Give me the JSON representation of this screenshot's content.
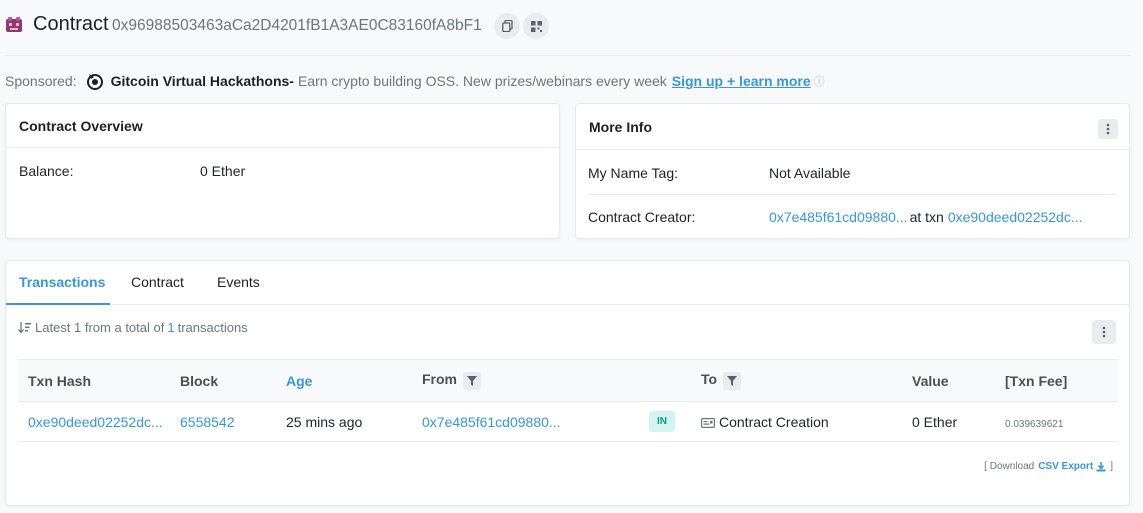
{
  "header": {
    "title": "Contract",
    "address": "0x96988503463aCa2D4201fB1A3AE0C83160fA8bF1"
  },
  "sponsored": {
    "label": "Sponsored:",
    "name": "Gitcoin Virtual Hackathons-",
    "text": "Earn crypto building OSS. New prizes/webinars every week",
    "link": "Sign up + learn more"
  },
  "overview": {
    "title": "Contract Overview",
    "balance_label": "Balance:",
    "balance_value": "0 Ether"
  },
  "more_info": {
    "title": "More Info",
    "name_tag_label": "My Name Tag:",
    "name_tag_value": "Not Available",
    "creator_label": "Contract Creator:",
    "creator_address": "0x7e485f61cd09880...",
    "at_txn": "at txn",
    "creator_txn": "0xe90deed02252dc..."
  },
  "tabs": [
    {
      "label": "Transactions"
    },
    {
      "label": "Contract"
    },
    {
      "label": "Events"
    }
  ],
  "summary": {
    "prefix": "Latest 1 from a total of",
    "count": "1",
    "suffix": "transactions"
  },
  "table": {
    "headers": {
      "txn_hash": "Txn Hash",
      "block": "Block",
      "age": "Age",
      "from": "From",
      "to": "To",
      "value": "Value",
      "fee": "[Txn Fee]"
    },
    "rows": [
      {
        "txn_hash": "0xe90deed02252dc...",
        "block": "6558542",
        "age": "25 mins ago",
        "from": "0x7e485f61cd09880...",
        "direction": "IN",
        "to": "Contract Creation",
        "value": "0 Ether",
        "fee": "0.039639621"
      }
    ]
  },
  "download": {
    "prefix": "[ Download",
    "link": "CSV Export",
    "suffix": "]"
  },
  "colors": {
    "accent": "#3498db",
    "in_badge_bg": "#d4f4ef",
    "in_badge_text": "#00a186"
  }
}
